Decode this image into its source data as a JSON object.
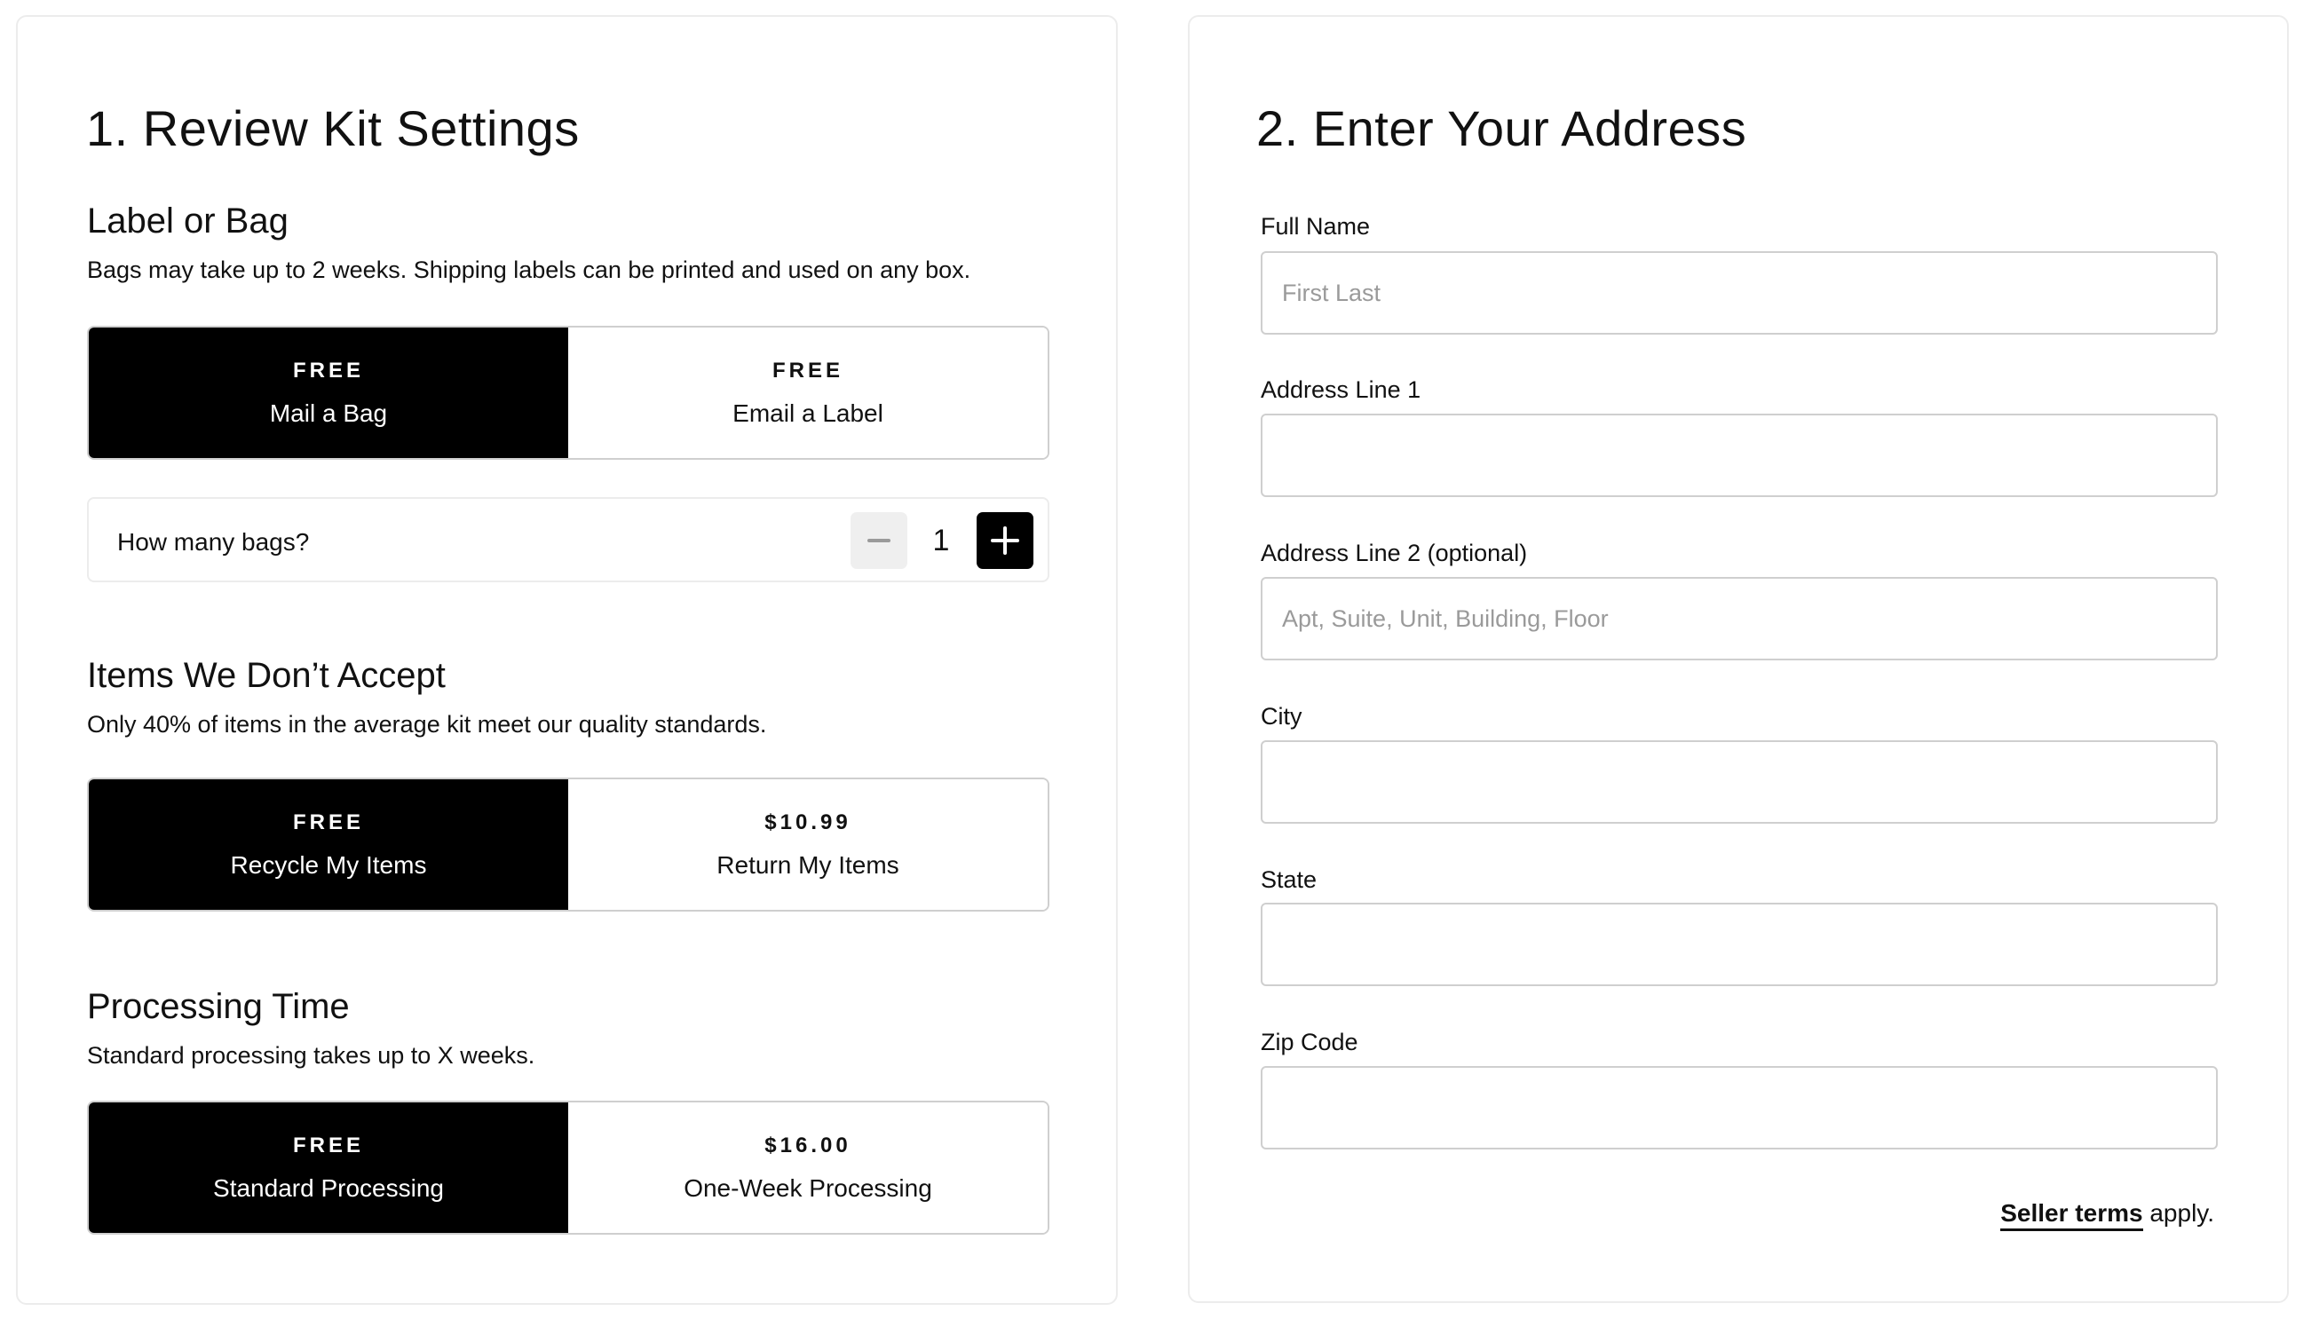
{
  "kit_settings": {
    "title": "1. Review Kit Settings",
    "label_or_bag": {
      "title": "Label or Bag",
      "description": "Bags may take up to 2 weeks. Shipping labels can be printed and used on any box.",
      "options": [
        {
          "price": "FREE",
          "name": "Mail a Bag",
          "selected": true
        },
        {
          "price": "FREE",
          "name": "Email a Label",
          "selected": false
        }
      ],
      "bag_count": {
        "label": "How many bags?",
        "value": "1",
        "decrement_icon": "minus-icon",
        "increment_icon": "plus-icon"
      }
    },
    "items_not_accepted": {
      "title": "Items We Don’t Accept",
      "description": "Only 40% of items in the average kit meet our quality standards.",
      "options": [
        {
          "price": "FREE",
          "name": "Recycle My Items",
          "selected": true
        },
        {
          "price": "$10.99",
          "name": "Return My Items",
          "selected": false
        }
      ]
    },
    "processing_time": {
      "title": "Processing Time",
      "description": "Standard processing takes up to X weeks.",
      "options": [
        {
          "price": "FREE",
          "name": "Standard Processing",
          "selected": true
        },
        {
          "price": "$16.00",
          "name": "One-Week Processing",
          "selected": false
        }
      ]
    }
  },
  "address": {
    "title": "2. Enter Your Address",
    "fields": [
      {
        "label": "Full Name",
        "placeholder": "First Last",
        "value": ""
      },
      {
        "label": "Address Line 1",
        "placeholder": "",
        "value": ""
      },
      {
        "label": "Address Line 2 (optional)",
        "placeholder": "Apt, Suite, Unit, Building, Floor",
        "value": ""
      },
      {
        "label": "City",
        "placeholder": "",
        "value": ""
      },
      {
        "label": "State",
        "placeholder": "",
        "value": ""
      },
      {
        "label": "Zip Code",
        "placeholder": "",
        "value": ""
      }
    ],
    "terms": {
      "link_text": "Seller terms",
      "suffix": " apply."
    }
  },
  "colors": {
    "selected_bg": "#000000",
    "unselected_bg": "#ffffff",
    "border": "#cfcfcf",
    "placeholder": "#9a9a9a"
  }
}
